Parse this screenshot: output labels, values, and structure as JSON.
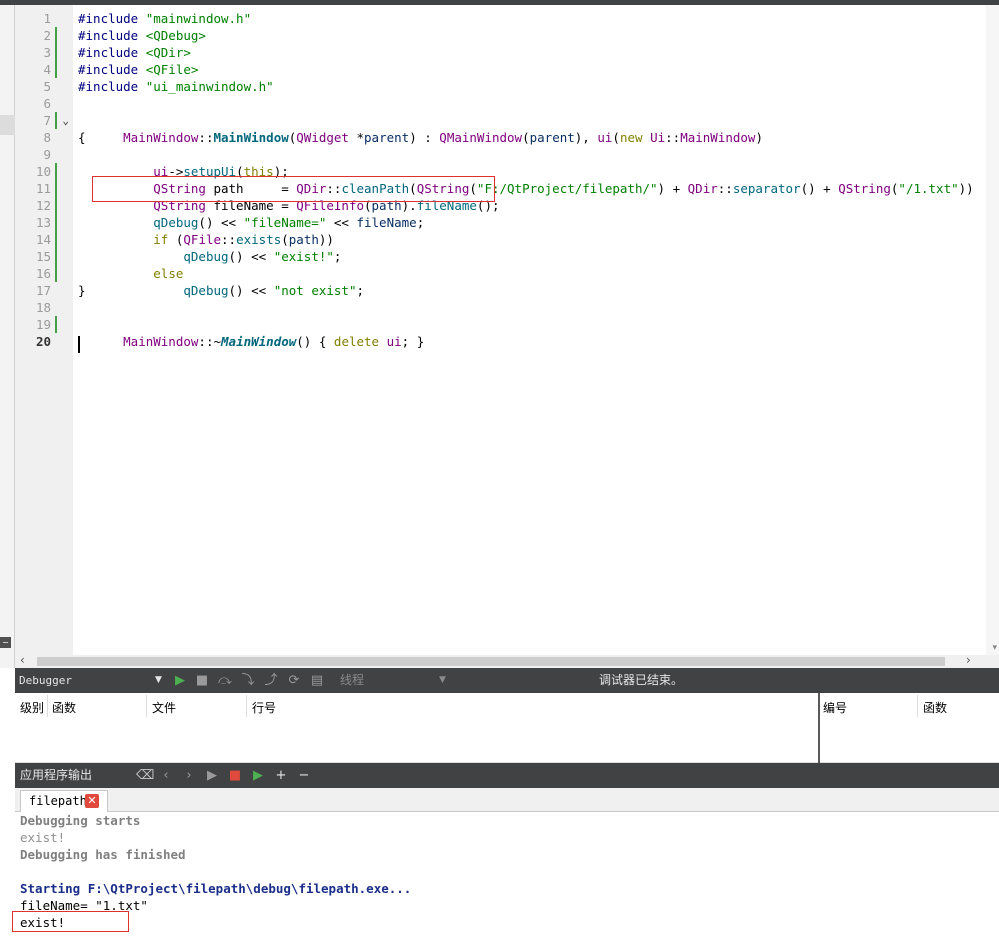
{
  "editor": {
    "line_numbers": [
      "1",
      "2",
      "3",
      "4",
      "5",
      "6",
      "7",
      "8",
      "9",
      "10",
      "11",
      "12",
      "13",
      "14",
      "15",
      "16",
      "17",
      "18",
      "19",
      "20"
    ],
    "current_line": "20",
    "code": {
      "l1": {
        "a": "#include ",
        "b": "\"mainwindow.h\""
      },
      "l2": {
        "a": "#include ",
        "b": "<QDebug>"
      },
      "l3": {
        "a": "#include ",
        "b": "<QDir>"
      },
      "l4": {
        "a": "#include ",
        "b": "<QFile>"
      },
      "l5": {
        "a": "#include ",
        "b": "\"ui_mainwindow.h\""
      },
      "l7": {
        "t1": "MainWindow",
        "t2": "::",
        "t3": "MainWindow",
        "t4": "(",
        "t5": "QWidget",
        "t6": " *",
        "t7": "parent",
        "t8": ") : ",
        "t9": "QMainWindow",
        "t10": "(",
        "t11": "parent",
        "t12": "), ",
        "t13": "ui",
        "t14": "(",
        "t15": "new",
        "t16": " ",
        "t17": "Ui",
        "t18": "::",
        "t19": "MainWindow",
        "t20": ")"
      },
      "l8": "{",
      "l9": {
        "t1": "    ",
        "t2": "ui",
        "t3": "->",
        "t4": "setupUi",
        "t5": "(",
        "t6": "this",
        "t7": ");"
      },
      "l10": {
        "t1": "    ",
        "t2": "QString",
        "t3": " path     = ",
        "t4": "QDir",
        "t5": "::",
        "t6": "cleanPath",
        "t7": "(",
        "t8": "QString",
        "t9": "(",
        "t10": "\"F:/QtProject/filepath/\"",
        "t11": ") + ",
        "t12": "QDir",
        "t13": "::",
        "t14": "separator",
        "t15": "() + ",
        "t16": "QString",
        "t17": "(",
        "t18": "\"/1.txt\"",
        "t19": "))"
      },
      "l11": {
        "t1": "    ",
        "t2": "QString",
        "t3": " fileName = ",
        "t4": "QFileInfo",
        "t5": "(",
        "t6": "path",
        "t7": ").",
        "t8": "fileName",
        "t9": "();"
      },
      "l12": {
        "t1": "    ",
        "t2": "qDebug",
        "t3": "() << ",
        "t4": "\"fileName=\"",
        "t5": " << ",
        "t6": "fileName",
        "t7": ";"
      },
      "l13": {
        "t1": "    ",
        "t2": "if",
        "t3": " (",
        "t4": "QFile",
        "t5": "::",
        "t6": "exists",
        "t7": "(",
        "t8": "path",
        "t9": "))"
      },
      "l14": {
        "t1": "        ",
        "t2": "qDebug",
        "t3": "() << ",
        "t4": "\"exist!\"",
        "t5": ";"
      },
      "l15": {
        "t1": "    ",
        "t2": "else"
      },
      "l16": {
        "t1": "        ",
        "t2": "qDebug",
        "t3": "() << ",
        "t4": "\"not exist\"",
        "t5": ";"
      },
      "l17": "}",
      "l19": {
        "t1": "MainWindow",
        "t2": "::",
        "t3": "~",
        "t4": "MainWindow",
        "t5": "() { ",
        "t6": "delete",
        "t7": " ",
        "t8": "ui",
        "t9": "; }"
      }
    },
    "fold_icon": "chevron-down-icon"
  },
  "debugger_toolbar": {
    "combo": "Debugger",
    "threads": "线程",
    "status": "调试器已结束。"
  },
  "debugger_pane": {
    "left_headers": [
      "级别",
      "函数",
      "文件",
      "行号"
    ],
    "right_headers": [
      "编号",
      "函数"
    ]
  },
  "output_toolbar": {
    "title": "应用程序输出"
  },
  "output": {
    "tab_label": "filepath",
    "close_glyph": "✕",
    "lines": [
      "Debugging starts",
      "exist!",
      "Debugging has finished",
      "",
      "Starting F:\\QtProject\\filepath\\debug\\filepath.exe...",
      "fileName= \"1.txt\"",
      "exist!"
    ]
  },
  "colors": {
    "toolbar_bg": "#404244",
    "highlight_box": "#e03030",
    "change_bar": "#45a045"
  }
}
